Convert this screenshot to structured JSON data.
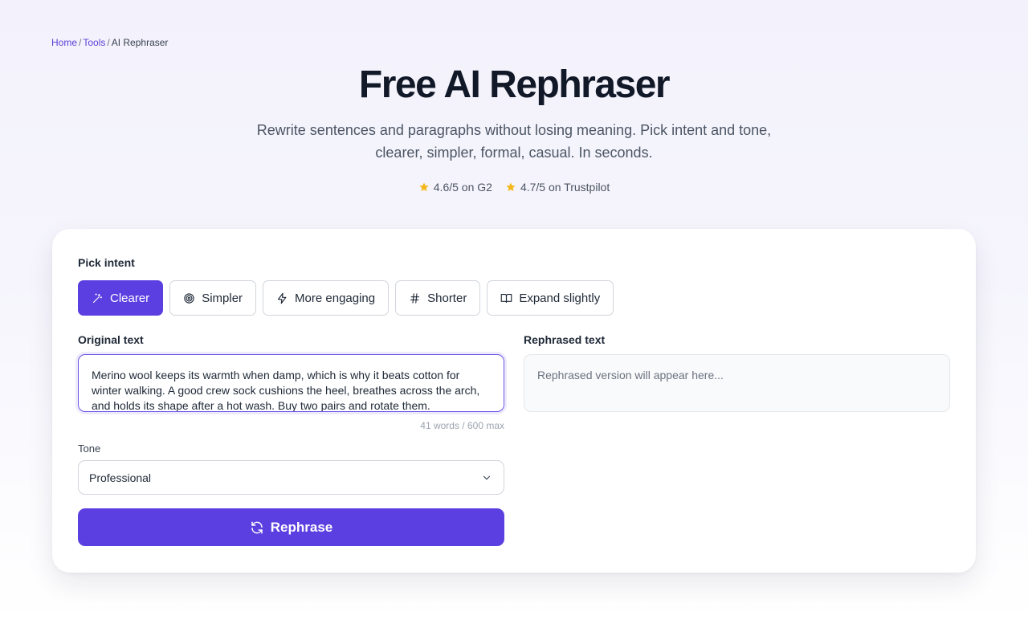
{
  "breadcrumb": {
    "home": "Home",
    "sep1": "/",
    "tools": "Tools",
    "sep2": "/",
    "current": "AI Rephraser"
  },
  "hero": {
    "title": "Free AI Rephraser",
    "subtitle": "Rewrite sentences and paragraphs without losing meaning. Pick intent and tone, clearer, simpler, formal, casual. In seconds."
  },
  "ratings": [
    {
      "text": "4.6/5 on G2",
      "icon": "star-icon"
    },
    {
      "text": "4.7/5 on Trustpilot",
      "icon": "star-icon"
    }
  ],
  "form": {
    "intent_label": "Pick intent",
    "intents": [
      {
        "label": "Clearer",
        "icon": "wand-icon",
        "active": true
      },
      {
        "label": "Simpler",
        "icon": "target-icon",
        "active": false
      },
      {
        "label": "More engaging",
        "icon": "bolt-icon",
        "active": false
      },
      {
        "label": "Shorter",
        "icon": "hash-icon",
        "active": false
      },
      {
        "label": "Expand slightly",
        "icon": "book-icon",
        "active": false
      }
    ],
    "original_label": "Original text",
    "original_value": "Merino wool keeps its warmth when damp, which is why it beats cotton for winter walking. A good crew sock cushions the heel, breathes across the arch, and holds its shape after a hot wash. Buy two pairs and rotate them.",
    "word_count": "41 words / 600 max",
    "tone_label": "Tone",
    "tone_value": "Professional",
    "submit_label": "Rephrase",
    "rephrased_label": "Rephrased text",
    "rephrased_placeholder": "Rephrased version will appear here..."
  },
  "colors": {
    "accent": "#5b3fe0",
    "star": "#f5b81c",
    "link": "#5b3fd6"
  }
}
